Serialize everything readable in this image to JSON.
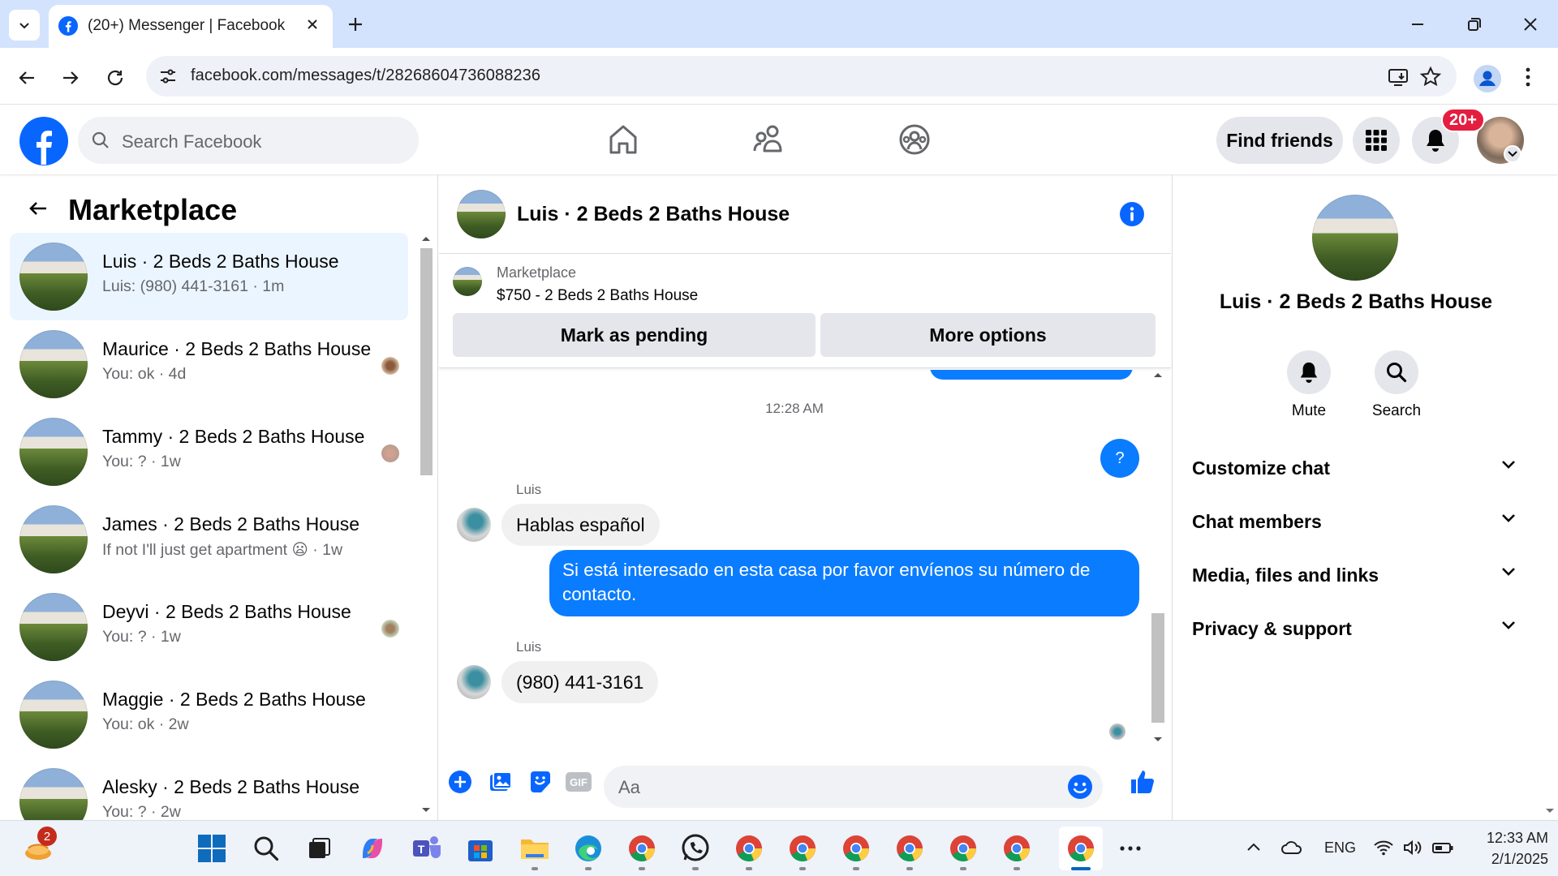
{
  "browser": {
    "tab_title": "(20+) Messenger | Facebook",
    "url": "facebook.com/messages/t/28268604736088236"
  },
  "fb": {
    "search_placeholder": "Search Facebook",
    "find_friends": "Find friends",
    "notif_count": "20+"
  },
  "left": {
    "title": "Marketplace",
    "conversations": [
      {
        "name": "Luis · 2 Beds 2 Baths House",
        "preview": "Luis: (980) 441-3161 · 1m",
        "active": true
      },
      {
        "name": "Maurice · 2 Beds 2 Baths House",
        "preview": "You: ok · 4d"
      },
      {
        "name": "Tammy · 2 Beds 2 Baths House",
        "preview": "You: ? · 1w"
      },
      {
        "name": "James · 2 Beds 2 Baths House",
        "preview": "If not I'll just get apartment 😦 · 1w"
      },
      {
        "name": "Deyvi · 2 Beds 2 Baths House",
        "preview": "You: ? · 1w"
      },
      {
        "name": "Maggie · 2 Beds 2 Baths House",
        "preview": "You: ok · 2w"
      },
      {
        "name": "Alesky · 2 Beds 2 Baths House",
        "preview": "You: ? · 2w"
      }
    ]
  },
  "chat": {
    "title": "Luis · 2 Beds 2 Baths House",
    "marketplace_label": "Marketplace",
    "listing": "$750 - 2 Beds 2 Baths House",
    "btn_pending": "Mark as pending",
    "btn_more": "More options",
    "time": "12:28 AM",
    "out_q": "?",
    "sender": "Luis",
    "msg1": "Hablas español",
    "out_long": "Si está interesado en esta casa por favor envíenos su número de contacto.",
    "msg2": "(980) 441-3161",
    "composer_placeholder": "Aa"
  },
  "right": {
    "name": "Luis · 2 Beds 2 Baths House",
    "mute": "Mute",
    "search": "Search",
    "sections": [
      "Customize chat",
      "Chat members",
      "Media, files and links",
      "Privacy & support"
    ]
  },
  "taskbar": {
    "badge": "2",
    "lang": "ENG",
    "time": "12:33 AM",
    "date": "2/1/2025"
  },
  "colors": {
    "fb_blue": "#0866ff",
    "bubble_blue": "#0a7cff",
    "badge_red": "#e41e3f"
  }
}
